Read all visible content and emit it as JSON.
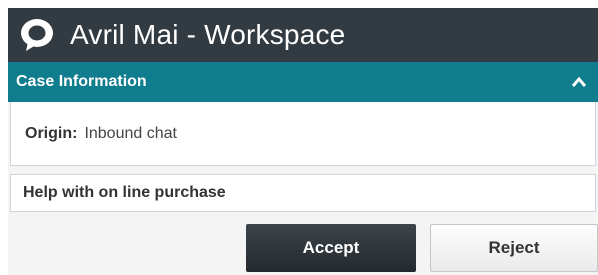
{
  "window": {
    "title": "Avril Mai - Workspace",
    "icon": "chat-bubble-icon"
  },
  "case_section": {
    "header": "Case Information",
    "collapse_icon": "chevron-up-icon",
    "origin_label": "Origin:",
    "origin_value": "Inbound chat"
  },
  "subject": "Help with on line purchase",
  "actions": {
    "accept_label": "Accept",
    "reject_label": "Reject"
  },
  "colors": {
    "titlebar": "#323b41",
    "section_header": "#107d8f",
    "accept_button": "#2f363b"
  }
}
